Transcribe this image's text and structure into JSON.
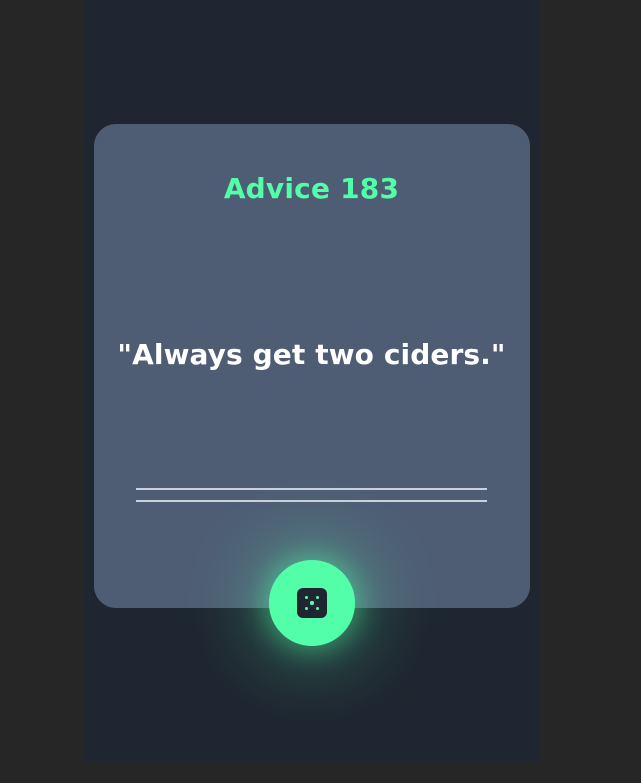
{
  "colors": {
    "outer_bg": "#262626",
    "app_bg": "#1f2631",
    "card_bg": "#4f5d74",
    "accent": "#52ffa8",
    "text_primary": "#ffffff",
    "divider": "#d7dde6"
  },
  "card": {
    "title": "Advice 183",
    "quote": "\"Always get two ciders.\""
  },
  "button": {
    "icon": "dice-icon",
    "tooltip": ""
  }
}
